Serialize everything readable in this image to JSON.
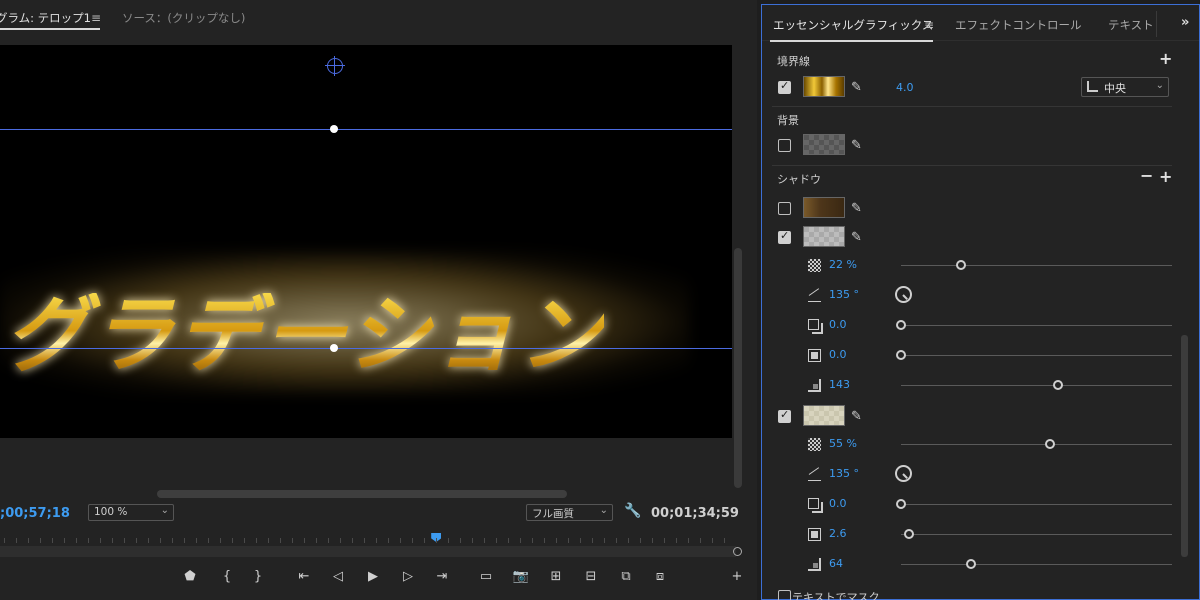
{
  "program_monitor": {
    "tab_label": "グラム: テロップ1",
    "tab_menu_glyph": "≡",
    "source_tab_label": "ソース：(クリップなし)",
    "title_text": "グラデーション",
    "timecode_current": ";00;57;18",
    "zoom": "100 %",
    "quality": "フル画質",
    "timecode_duration": "00;01;34;59",
    "playhead_fraction": 0.6,
    "controls": [
      {
        "name": "add-marker-icon",
        "glyph": "⬟"
      },
      {
        "name": "mark-in-icon",
        "glyph": "{"
      },
      {
        "name": "mark-out-icon",
        "glyph": "}"
      },
      {
        "name": "go-to-in-icon",
        "glyph": "⇤"
      },
      {
        "name": "step-back-icon",
        "glyph": "◁"
      },
      {
        "name": "play-icon",
        "glyph": "▶"
      },
      {
        "name": "step-forward-icon",
        "glyph": "▷"
      },
      {
        "name": "go-to-out-icon",
        "glyph": "⇥"
      },
      {
        "name": "safe-margins-icon",
        "glyph": "▭"
      },
      {
        "name": "export-frame-icon",
        "glyph": "📷"
      },
      {
        "name": "lift-icon",
        "glyph": "⊞"
      },
      {
        "name": "extract-icon",
        "glyph": "⊟"
      },
      {
        "name": "insert-icon",
        "glyph": "⧉"
      },
      {
        "name": "overwrite-icon",
        "glyph": "⧈"
      },
      {
        "name": "button-editor-icon",
        "glyph": "+"
      }
    ]
  },
  "essential_graphics": {
    "tab_label": "エッセンシャルグラフィックス",
    "tab_menu_glyph": "≡",
    "effect_controls_tab": "エフェクトコントロール",
    "text_tab": "テキスト",
    "more_glyph": "»",
    "stroke": {
      "label": "境界線",
      "enabled": true,
      "width": "4.0",
      "position": "中央"
    },
    "background": {
      "label": "背景",
      "enabled": false
    },
    "shadow": {
      "label": "シャドウ",
      "shadows": [
        {
          "enabled": false,
          "swatch": "brown"
        },
        {
          "enabled": true,
          "swatch": "light",
          "opacity": "22 %",
          "opacity_level": 0.22,
          "angle": "135 °",
          "distance": "0.0",
          "distance_level": 0.0,
          "size": "0.0",
          "size_level": 0.0,
          "blur": "143",
          "blur_level": 0.58
        },
        {
          "enabled": true,
          "swatch": "cream",
          "opacity": "55 %",
          "opacity_level": 0.55,
          "angle": "135 °",
          "distance": "0.0",
          "distance_level": 0.0,
          "size": "2.6",
          "size_level": 0.03,
          "blur": "64",
          "blur_level": 0.26
        }
      ]
    },
    "mask_with_text_label": "テキストでマスク"
  }
}
